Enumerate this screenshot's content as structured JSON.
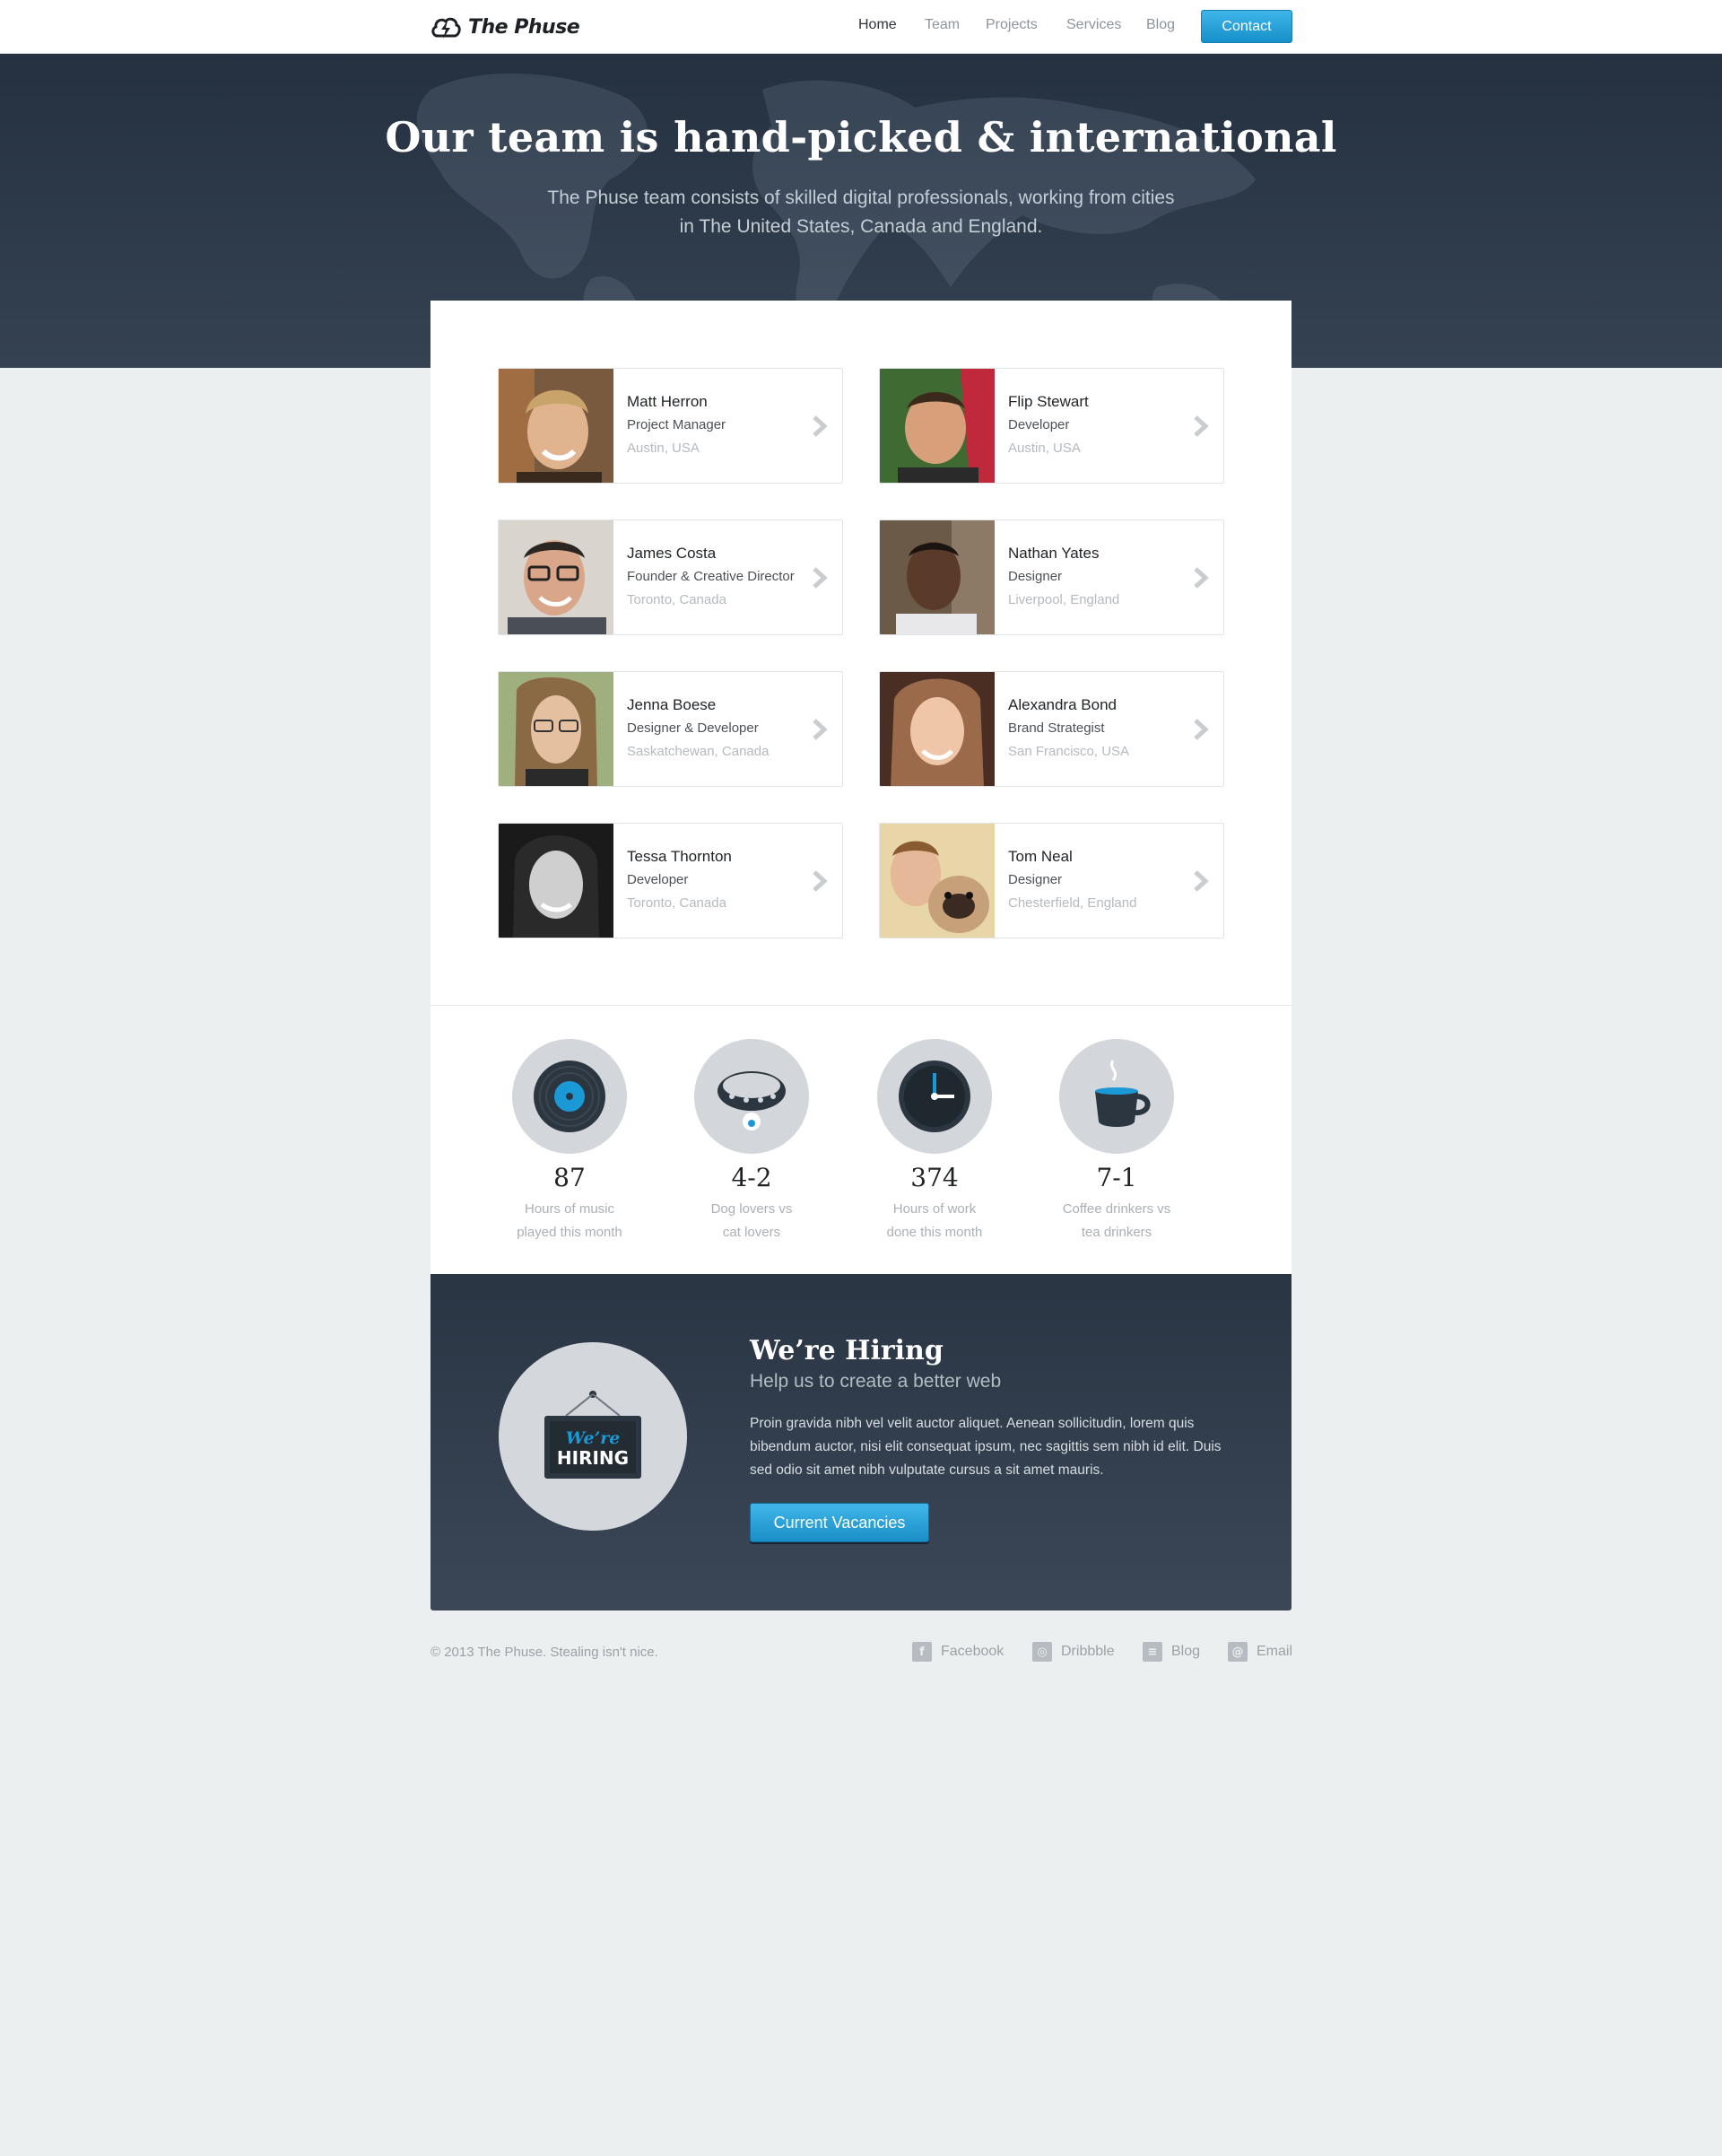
{
  "brand": {
    "name": "The Phuse"
  },
  "nav": {
    "items": [
      {
        "label": "Home",
        "active": true
      },
      {
        "label": "Team",
        "active": false
      },
      {
        "label": "Projects",
        "active": false
      },
      {
        "label": "Services",
        "active": false
      },
      {
        "label": "Blog",
        "active": false
      }
    ],
    "contact_label": "Contact"
  },
  "hero": {
    "title": "Our team is hand-picked & international",
    "subtitle": "The Phuse team consists of skilled digital professionals, working from cities in The United States, Canada and England."
  },
  "team": [
    {
      "name": "Matt Herron",
      "role": "Project Manager",
      "location": "Austin, USA"
    },
    {
      "name": "Flip Stewart",
      "role": "Developer",
      "location": "Austin, USA"
    },
    {
      "name": "James Costa",
      "role": "Founder & Creative Director",
      "location": "Toronto, Canada"
    },
    {
      "name": "Nathan Yates",
      "role": "Designer",
      "location": "Liverpool, England"
    },
    {
      "name": "Jenna Boese",
      "role": "Designer & Developer",
      "location": "Saskatchewan, Canada"
    },
    {
      "name": "Alexandra Bond",
      "role": "Brand Strategist",
      "location": "San Francisco, USA"
    },
    {
      "name": "Tessa Thornton",
      "role": "Developer",
      "location": "Toronto, Canada"
    },
    {
      "name": "Tom Neal",
      "role": "Designer",
      "location": "Chesterfield, England"
    }
  ],
  "stats": [
    {
      "value": "87",
      "label_line1": "Hours of music",
      "label_line2": "played this month",
      "icon": "vinyl-record-icon"
    },
    {
      "value": "4-2",
      "label_line1": "Dog lovers vs",
      "label_line2": "cat lovers",
      "icon": "dog-collar-icon"
    },
    {
      "value": "374",
      "label_line1": "Hours of work",
      "label_line2": "done this month",
      "icon": "clock-icon"
    },
    {
      "value": "7-1",
      "label_line1": "Coffee drinkers vs",
      "label_line2": "tea drinkers",
      "icon": "coffee-cup-icon"
    }
  ],
  "hiring": {
    "title": "We’re Hiring",
    "subtitle": "Help us to create a better web",
    "body": "Proin gravida nibh vel velit auctor aliquet. Aenean sollicitudin, lorem quis bibendum auctor, nisi elit consequat ipsum, nec sagittis sem nibh id elit. Duis sed odio sit amet nibh vulputate cursus a sit amet mauris.",
    "button_label": "Current Vacancies",
    "sign_line1": "We’re",
    "sign_line2": "HIRING"
  },
  "footer": {
    "copyright": "© 2013 The Phuse. Stealing isn't nice.",
    "links": [
      {
        "label": "Facebook",
        "icon": "facebook-icon",
        "glyph": "f"
      },
      {
        "label": "Dribbble",
        "icon": "dribbble-icon",
        "glyph": "◎"
      },
      {
        "label": "Blog",
        "icon": "blog-icon",
        "glyph": "≡"
      },
      {
        "label": "Email",
        "icon": "email-icon",
        "glyph": "@"
      }
    ]
  },
  "colors": {
    "accent": "#1a99d6",
    "hero_bg": "#2c3848",
    "page_bg": "#eceff0"
  }
}
